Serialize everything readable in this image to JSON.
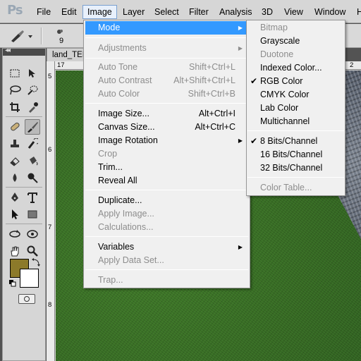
{
  "app": {
    "logo": "Ps"
  },
  "menubar": [
    "File",
    "Edit",
    "Image",
    "Layer",
    "Select",
    "Filter",
    "Analysis",
    "3D",
    "View",
    "Window",
    "H"
  ],
  "options": {
    "brush_size": "9"
  },
  "document": {
    "tab_title": "land_TEM",
    "ruler_top": [
      "17",
      "2"
    ],
    "ruler_left": [
      "5",
      "6",
      "7",
      "8"
    ]
  },
  "image_menu": {
    "mode": "Mode",
    "adjustments": "Adjustments",
    "auto_tone": "Auto Tone",
    "auto_tone_sc": "Shift+Ctrl+L",
    "auto_contrast": "Auto Contrast",
    "auto_contrast_sc": "Alt+Shift+Ctrl+L",
    "auto_color": "Auto Color",
    "auto_color_sc": "Shift+Ctrl+B",
    "image_size": "Image Size...",
    "image_size_sc": "Alt+Ctrl+I",
    "canvas_size": "Canvas Size...",
    "canvas_size_sc": "Alt+Ctrl+C",
    "image_rotation": "Image Rotation",
    "crop": "Crop",
    "trim": "Trim...",
    "reveal_all": "Reveal All",
    "duplicate": "Duplicate...",
    "apply_image": "Apply Image...",
    "calculations": "Calculations...",
    "variables": "Variables",
    "apply_data_set": "Apply Data Set...",
    "trap": "Trap..."
  },
  "mode_menu": {
    "bitmap": "Bitmap",
    "grayscale": "Grayscale",
    "duotone": "Duotone",
    "indexed": "Indexed Color...",
    "rgb": "RGB Color",
    "cmyk": "CMYK Color",
    "lab": "Lab Color",
    "multichannel": "Multichannel",
    "bits8": "8 Bits/Channel",
    "bits16": "16 Bits/Channel",
    "bits32": "32 Bits/Channel",
    "color_table": "Color Table..."
  },
  "colors": {
    "foreground": "#8c7a2a",
    "background": "#ffffff",
    "menu_highlight": "#3399ff"
  }
}
